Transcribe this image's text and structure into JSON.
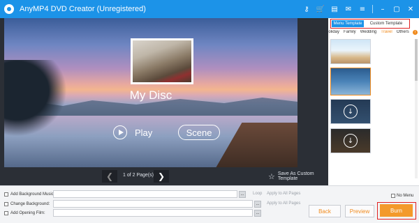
{
  "window": {
    "title": "AnyMP4 DVD Creator (Unregistered)",
    "icons": [
      "key-icon",
      "cart-icon",
      "register-icon",
      "chat-icon",
      "menu-icon",
      "minimize-icon",
      "maximize-icon",
      "close-icon"
    ],
    "accent": "#1c93e8"
  },
  "preview": {
    "disc_title": "My Disc",
    "play_label": "Play",
    "scene_label": "Scene",
    "pager_text": "1 of 2 Page(s)",
    "save_custom_label": "Save As Custom Template"
  },
  "sidebar": {
    "tabs": [
      {
        "label": "Menu Template",
        "active": true
      },
      {
        "label": "Custom Template",
        "active": false
      }
    ],
    "categories": [
      {
        "label": "Holiday",
        "active": false
      },
      {
        "label": "Family",
        "active": false
      },
      {
        "label": "Wedding",
        "active": false
      },
      {
        "label": "Travel",
        "active": true
      },
      {
        "label": "Others",
        "active": false
      }
    ],
    "templates": [
      {
        "name": "template-1",
        "selected": false
      },
      {
        "name": "template-2",
        "selected": true
      },
      {
        "name": "template-3",
        "selected": false
      },
      {
        "name": "template-4",
        "selected": false
      }
    ]
  },
  "options": {
    "bg_music_label": "Add Background Music:",
    "change_bg_label": "Change Background:",
    "opening_film_label": "Add Opening Film:",
    "loop_label": "Loop",
    "apply_all_label": "Apply to All Pages",
    "browse_label": "...",
    "no_menu_label": "No Menu"
  },
  "actions": {
    "back_label": "Back",
    "preview_label": "Preview",
    "burn_label": "Burn",
    "burn_color": "#f39a2b"
  }
}
